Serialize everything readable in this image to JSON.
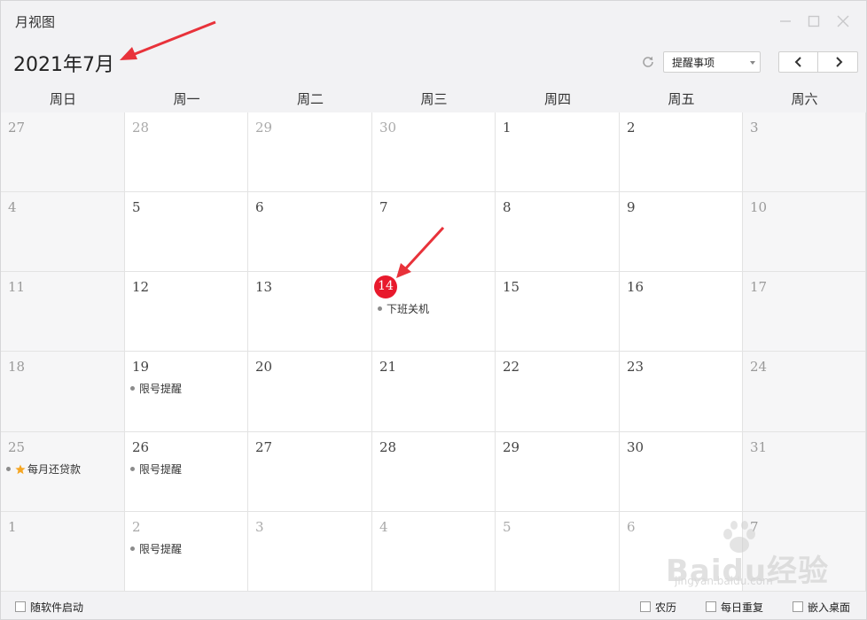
{
  "window": {
    "title": "月视图",
    "controls": [
      "minimize-icon",
      "maximize-icon",
      "close-icon"
    ]
  },
  "header": {
    "month_title": "2021年7月",
    "refresh_icon": "refresh-icon",
    "filter_select": {
      "value": "提醒事项"
    },
    "prev_icon": "chevron-left-icon",
    "next_icon": "chevron-right-icon"
  },
  "weekdays": [
    "周日",
    "周一",
    "周二",
    "周三",
    "周四",
    "周五",
    "周六"
  ],
  "weeks": [
    [
      {
        "day": "27",
        "current": false,
        "events": []
      },
      {
        "day": "28",
        "current": false,
        "events": []
      },
      {
        "day": "29",
        "current": false,
        "events": []
      },
      {
        "day": "30",
        "current": false,
        "events": []
      },
      {
        "day": "1",
        "current": true,
        "events": []
      },
      {
        "day": "2",
        "current": true,
        "events": []
      },
      {
        "day": "3",
        "current": true,
        "events": []
      }
    ],
    [
      {
        "day": "4",
        "current": true,
        "events": []
      },
      {
        "day": "5",
        "current": true,
        "events": []
      },
      {
        "day": "6",
        "current": true,
        "events": []
      },
      {
        "day": "7",
        "current": true,
        "events": []
      },
      {
        "day": "8",
        "current": true,
        "events": []
      },
      {
        "day": "9",
        "current": true,
        "events": []
      },
      {
        "day": "10",
        "current": true,
        "events": []
      }
    ],
    [
      {
        "day": "11",
        "current": true,
        "events": []
      },
      {
        "day": "12",
        "current": true,
        "events": []
      },
      {
        "day": "13",
        "current": true,
        "events": []
      },
      {
        "day": "14",
        "current": true,
        "today": true,
        "events": [
          {
            "text": "下班关机"
          }
        ]
      },
      {
        "day": "15",
        "current": true,
        "events": []
      },
      {
        "day": "16",
        "current": true,
        "events": []
      },
      {
        "day": "17",
        "current": true,
        "events": []
      }
    ],
    [
      {
        "day": "18",
        "current": true,
        "events": []
      },
      {
        "day": "19",
        "current": true,
        "events": [
          {
            "text": "限号提醒"
          }
        ]
      },
      {
        "day": "20",
        "current": true,
        "events": []
      },
      {
        "day": "21",
        "current": true,
        "events": []
      },
      {
        "day": "22",
        "current": true,
        "events": []
      },
      {
        "day": "23",
        "current": true,
        "events": []
      },
      {
        "day": "24",
        "current": true,
        "events": []
      }
    ],
    [
      {
        "day": "25",
        "current": true,
        "events": [
          {
            "text": "每月还贷款",
            "starred": true
          }
        ]
      },
      {
        "day": "26",
        "current": true,
        "events": [
          {
            "text": "限号提醒"
          }
        ]
      },
      {
        "day": "27",
        "current": true,
        "events": []
      },
      {
        "day": "28",
        "current": true,
        "events": []
      },
      {
        "day": "29",
        "current": true,
        "events": []
      },
      {
        "day": "30",
        "current": true,
        "events": []
      },
      {
        "day": "31",
        "current": true,
        "events": []
      }
    ],
    [
      {
        "day": "1",
        "current": false,
        "events": []
      },
      {
        "day": "2",
        "current": false,
        "events": [
          {
            "text": "限号提醒"
          }
        ]
      },
      {
        "day": "3",
        "current": false,
        "events": []
      },
      {
        "day": "4",
        "current": false,
        "events": []
      },
      {
        "day": "5",
        "current": false,
        "events": []
      },
      {
        "day": "6",
        "current": false,
        "events": []
      },
      {
        "day": "7",
        "current": false,
        "events": []
      }
    ]
  ],
  "footer": {
    "autostart_label": "随软件启动",
    "lunar_label": "农历",
    "daily_repeat_label": "每日重复",
    "embed_desktop_label": "嵌入桌面"
  },
  "watermark": {
    "logo_text": "Baidu经验",
    "url_text": "jingyan.baidu.com"
  },
  "colors": {
    "today_marker": "#e8192c",
    "annotation_arrow": "#e8323a",
    "star": "#f5a623"
  }
}
